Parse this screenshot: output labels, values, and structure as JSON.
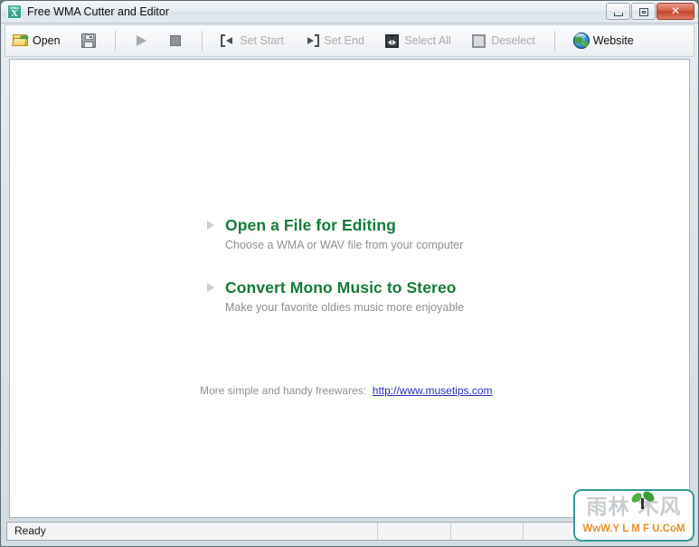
{
  "window": {
    "title": "Free WMA Cutter and Editor",
    "icon": "wma-app-icon",
    "icon_top_text": "WMA",
    "icon_glyph": "X",
    "controls": [
      {
        "name": "minimize",
        "label": "–"
      },
      {
        "name": "maximize",
        "label": "□"
      },
      {
        "name": "close",
        "label": "✕"
      }
    ]
  },
  "toolbar": {
    "items": [
      {
        "name": "open",
        "label": "Open",
        "icon": "open-folder-icon",
        "enabled": true
      },
      {
        "name": "save",
        "label": "",
        "icon": "save-floppy-icon",
        "enabled": false
      },
      {
        "name": "play",
        "label": "",
        "icon": "play-icon",
        "enabled": false
      },
      {
        "name": "stop",
        "label": "",
        "icon": "stop-icon",
        "enabled": false
      },
      {
        "name": "set-start",
        "label": "Set Start",
        "icon": "set-start-icon",
        "enabled": false
      },
      {
        "name": "set-end",
        "label": "Set End",
        "icon": "set-end-icon",
        "enabled": false
      },
      {
        "name": "select-all",
        "label": "Select All",
        "icon": "select-all-icon",
        "enabled": false
      },
      {
        "name": "deselect",
        "label": "Deselect",
        "icon": "deselect-icon",
        "enabled": false
      },
      {
        "name": "website",
        "label": "Website",
        "icon": "globe-icon",
        "enabled": true
      }
    ]
  },
  "main": {
    "choices": [
      {
        "title": "Open a File for Editing",
        "subtitle": "Choose a WMA or WAV file from your computer"
      },
      {
        "title": "Convert Mono Music to Stereo",
        "subtitle": "Make your favorite oldies music more enjoyable"
      }
    ],
    "footnote_text": "More simple and handy freewares:",
    "footnote_link": "http://www.musetips.com"
  },
  "statusbar": {
    "message": "Ready",
    "panels": [
      "",
      "",
      "",
      ""
    ]
  },
  "watermark": {
    "chinese": "雨林  木风",
    "url": "WwW.Y L M F U.CoM"
  },
  "colors": {
    "accent_green": "#157b38",
    "link_blue": "#2b2bbd",
    "muted_gray": "#8d9093",
    "close_red": "#c4432c",
    "watermark_teal": "#2e9c9a",
    "watermark_orange": "#e8902a"
  }
}
